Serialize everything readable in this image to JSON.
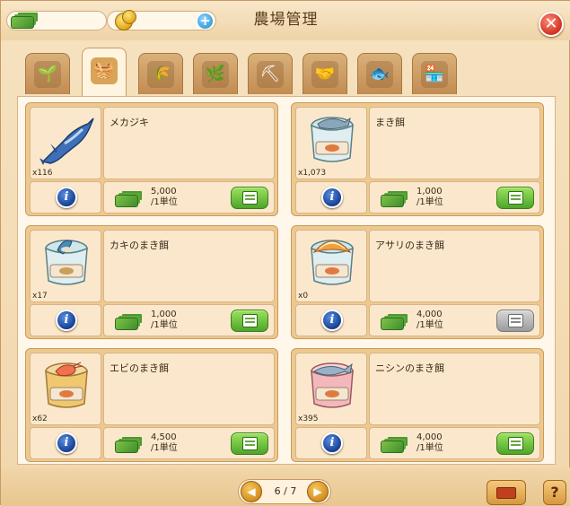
{
  "header": {
    "title": "農場管理",
    "close_symbol": "✕"
  },
  "currency": {
    "money_icon": "cash-icon",
    "coin_icon": "coin-icon",
    "add_symbol": "+"
  },
  "tabs": [
    {
      "icon": "sprout-icon",
      "glyph": "🌱",
      "active": false
    },
    {
      "icon": "basket-icon",
      "glyph": "🧺",
      "active": true
    },
    {
      "icon": "hay-bale-icon",
      "glyph": "🌾",
      "active": false
    },
    {
      "icon": "seed-bag-icon",
      "glyph": "🌿",
      "active": false
    },
    {
      "icon": "pickaxe-icon",
      "glyph": "⛏",
      "active": false
    },
    {
      "icon": "handshake-icon",
      "glyph": "🤝",
      "active": false
    },
    {
      "icon": "fish-icon",
      "glyph": "🐟",
      "active": false
    },
    {
      "icon": "market-stall-icon",
      "glyph": "🏪",
      "active": false
    }
  ],
  "items": [
    {
      "name": "メカジキ",
      "qty": "x116",
      "price": "5,000",
      "unit": "/1単位",
      "icon": "swordfish-icon",
      "buy_enabled": true
    },
    {
      "name": "まき餌",
      "qty": "x1,073",
      "price": "1,000",
      "unit": "/1単位",
      "icon": "fish-bait-bucket-icon",
      "buy_enabled": true
    },
    {
      "name": "カキのまき餌",
      "qty": "x17",
      "price": "1,000",
      "unit": "/1単位",
      "icon": "oyster-bait-bucket-icon",
      "buy_enabled": true
    },
    {
      "name": "アサリのまき餌",
      "qty": "x0",
      "price": "4,000",
      "unit": "/1単位",
      "icon": "clam-bait-bucket-icon",
      "buy_enabled": false
    },
    {
      "name": "エビのまき餌",
      "qty": "x62",
      "price": "4,500",
      "unit": "/1単位",
      "icon": "shrimp-bait-bucket-icon",
      "buy_enabled": true
    },
    {
      "name": "ニシンのまき餌",
      "qty": "x395",
      "price": "4,000",
      "unit": "/1単位",
      "icon": "herring-bait-bucket-icon",
      "buy_enabled": true
    }
  ],
  "info_symbol": "i",
  "pager": {
    "text": "6 / 7",
    "prev_symbol": "◀",
    "next_symbol": "▶"
  },
  "help_symbol": "?",
  "colors": {
    "buy_green": "#4ea52a",
    "buy_disabled": "#9a9a9a",
    "info_blue": "#123a8e",
    "close_red": "#d0321e"
  }
}
